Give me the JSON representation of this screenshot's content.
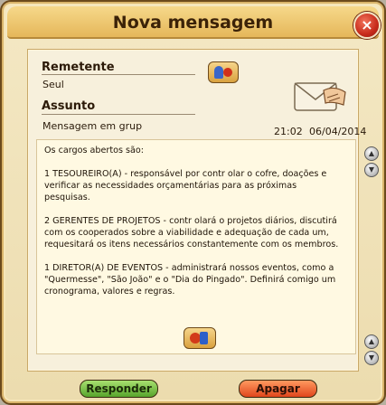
{
  "window": {
    "title": "Nova mensagem",
    "close_label": "×"
  },
  "header": {
    "sender_label": "Remetente",
    "sender_value": "Seul",
    "subject_label": "Assunto",
    "subject_value": "Mensagem em grup",
    "time": "21:02",
    "date": "06/04/2014"
  },
  "body": {
    "paragraphs": [
      "Os cargos abertos são:",
      "1 TESOUREIRO(A) - responsável por contr olar o cofre, doações e verificar as necessidades orçamentárias para as próximas pesquisas.",
      "2 GERENTES DE PROJETOS - contr olará o projetos diários, discutirá com os cooperados sobre a viabilidade e adequação de cada um, requesitará os itens necessários constantemente com os membros.",
      "1 DIRETOR(A) DE EVENTOS - administrará nossos eventos, como a \"Quermesse\", \"São João\" e o \"Dia do Pingado\". Definirá comigo um cronograma, valores e regras."
    ]
  },
  "scroll": {
    "up": "▲",
    "down": "▼"
  },
  "footer": {
    "reply_label": "Responder",
    "delete_label": "Apagar"
  },
  "colors": {
    "accent": "#e5b75a",
    "reply": "#57a42c",
    "delete": "#e0461c"
  }
}
